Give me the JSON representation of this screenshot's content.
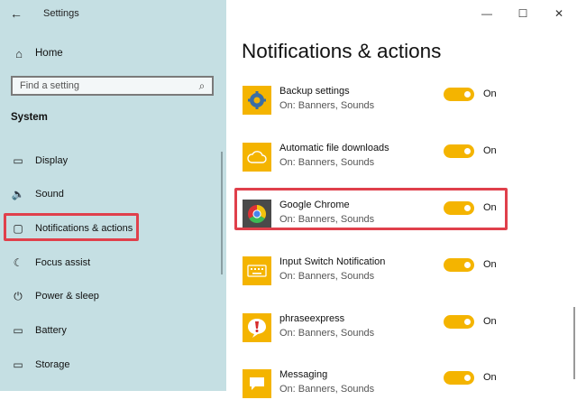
{
  "window": {
    "title": "Settings",
    "controls": {
      "minimize": "—",
      "maximize": "☐",
      "close": "✕"
    }
  },
  "sidebar": {
    "back_glyph": "←",
    "home_label": "Home",
    "search_placeholder": "Find a setting",
    "section_title": "System",
    "items": [
      {
        "label": "Display",
        "icon": "display-icon",
        "glyph": "▭"
      },
      {
        "label": "Sound",
        "icon": "sound-icon",
        "glyph": "🔈"
      },
      {
        "label": "Notifications & actions",
        "icon": "notifications-icon",
        "glyph": "▢",
        "selected": true
      },
      {
        "label": "Focus assist",
        "icon": "focus-assist-icon",
        "glyph": "☾"
      },
      {
        "label": "Power & sleep",
        "icon": "power-icon",
        "glyph": "⏻"
      },
      {
        "label": "Battery",
        "icon": "battery-icon",
        "glyph": "▭"
      },
      {
        "label": "Storage",
        "icon": "storage-icon",
        "glyph": "▭"
      }
    ]
  },
  "main": {
    "page_title": "Notifications & actions",
    "apps": [
      {
        "name": "Backup settings",
        "subtitle": "On: Banners, Sounds",
        "state": "On",
        "icon": "gear-icon"
      },
      {
        "name": "Automatic file downloads",
        "subtitle": "On: Banners, Sounds",
        "state": "On",
        "icon": "cloud-icon"
      },
      {
        "name": "Google Chrome",
        "subtitle": "On: Banners, Sounds",
        "state": "On",
        "icon": "chrome-icon"
      },
      {
        "name": "Input Switch Notification",
        "subtitle": "On: Banners, Sounds",
        "state": "On",
        "icon": "keyboard-icon"
      },
      {
        "name": "phraseexpress",
        "subtitle": "On: Banners, Sounds",
        "state": "On",
        "icon": "phraseexpress-icon"
      },
      {
        "name": "Messaging",
        "subtitle": "On: Banners, Sounds",
        "state": "On",
        "icon": "messaging-icon"
      }
    ]
  },
  "colors": {
    "sidebar_bg": "#c5dfe3",
    "accent": "#f4b400",
    "highlight": "#e0404b"
  }
}
